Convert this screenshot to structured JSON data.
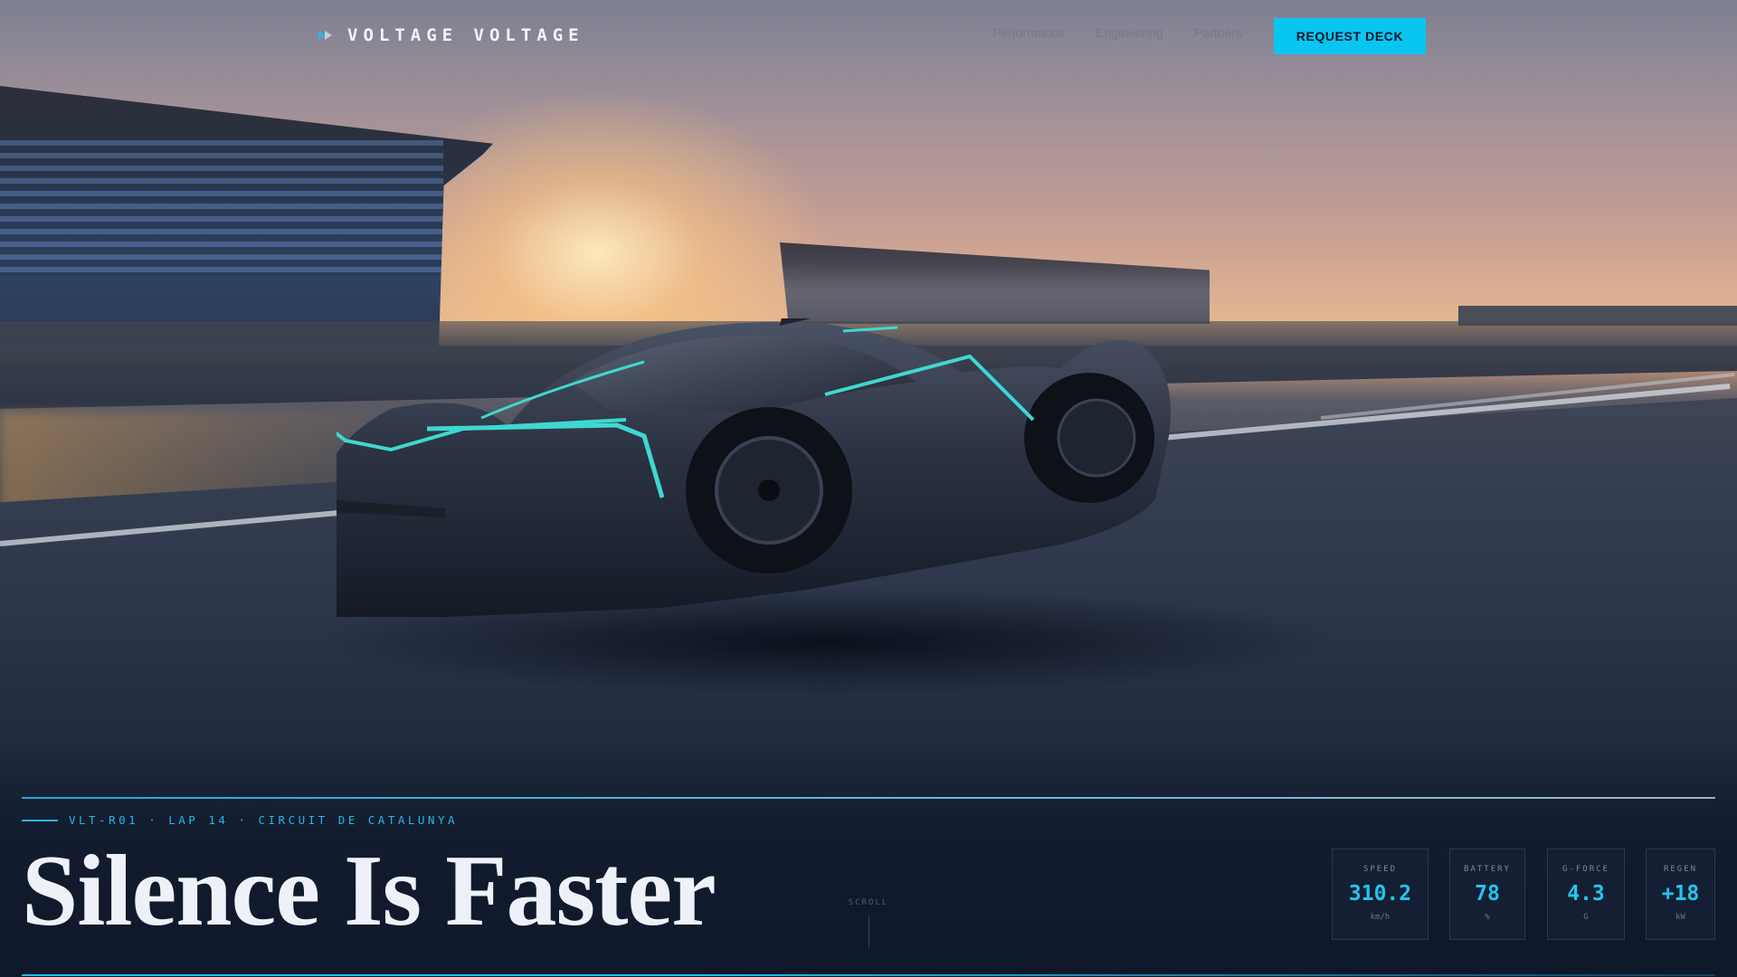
{
  "header": {
    "brand": "VOLTAGE VOLTAGE",
    "brand_icon": "chevron-arrow-icon",
    "nav": [
      "Performance",
      "Engineering",
      "Partners"
    ],
    "cta_label": "REQUEST DECK"
  },
  "hero": {
    "meta": "VLT-R01 · LAP 14 · CIRCUIT DE CATALUNYA",
    "headline": "Silence Is Faster",
    "scroll_label": "SCROLL"
  },
  "stats": [
    {
      "label": "SPEED",
      "value": "310.2",
      "unit": "km/h"
    },
    {
      "label": "BATTERY",
      "value": "78",
      "unit": "%"
    },
    {
      "label": "G-FORCE",
      "value": "4.3",
      "unit": "G"
    },
    {
      "label": "REGEN",
      "value": "+18",
      "unit": "kW"
    }
  ],
  "colors": {
    "accent": "#08c6f0",
    "background": "#0f1a2c",
    "headline": "#eef2f8"
  }
}
